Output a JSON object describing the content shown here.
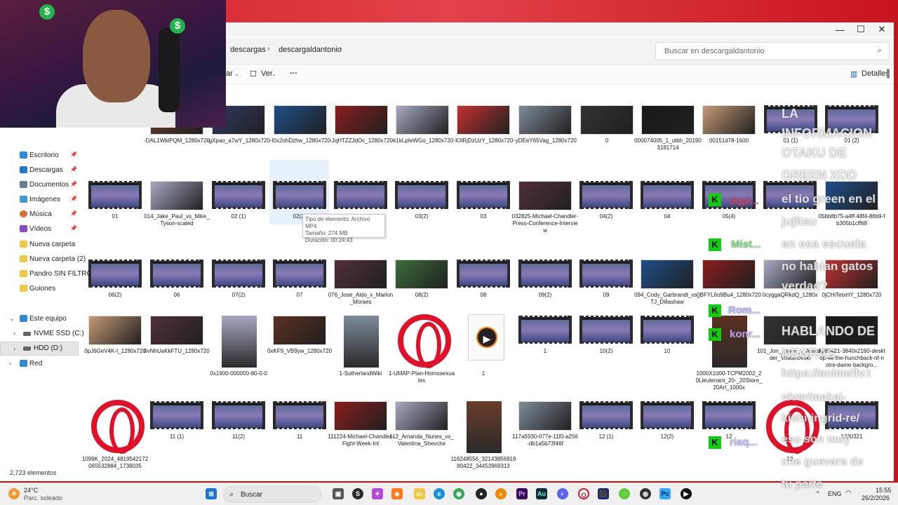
{
  "window": {
    "breadcrumbs": [
      "descargas",
      "descargaldantonio"
    ],
    "search_placeholder": "Buscar en descargaldantonio",
    "commands": {
      "sort_partial": "ar",
      "view": "Ver",
      "more": "···",
      "details": "Detalles"
    },
    "controls": {
      "minimize": "—",
      "maximize": "☐",
      "close": "✕"
    }
  },
  "sidebar": {
    "items": [
      {
        "label": "Escritorio",
        "icon": "desktop-icon",
        "pinned": true
      },
      {
        "label": "Descargas",
        "icon": "download-icon",
        "pinned": true
      },
      {
        "label": "Documentos",
        "icon": "document-icon",
        "pinned": true
      },
      {
        "label": "Imágenes",
        "icon": "image-icon",
        "pinned": true
      },
      {
        "label": "Música",
        "icon": "music-icon",
        "pinned": true
      },
      {
        "label": "Vídeos",
        "icon": "video-icon",
        "pinned": true
      },
      {
        "label": "Nueva carpeta",
        "icon": "folder-icon",
        "pinned": false
      },
      {
        "label": "Nueva carpeta (2)",
        "icon": "folder-icon",
        "pinned": false
      },
      {
        "label": "Pandro SIN FILTROS",
        "icon": "folder-icon",
        "pinned": false
      },
      {
        "label": "Guiones",
        "icon": "folder-icon",
        "pinned": false
      }
    ],
    "this_pc": "Este equipo",
    "drives": [
      "NVME SSD (C:)",
      "HDD (D:)"
    ],
    "network": "Red"
  },
  "files": {
    "row1": [
      "-DAL1WklPQM_1280x720",
      "-gXpao_a7wY_1280x720",
      "-l0x2ohDzhw_1280x720",
      "-JqHTZZJdOc_1280x720",
      "-k1kLpIeWGo_1280x720",
      "-lOIRjDzUzY_1280x720",
      "-yDEeY65Vag_1280x720",
      "0",
      "000074005_1_utbh_201903181714",
      "00151d78-1600",
      "01 (1)",
      "01 (2)"
    ],
    "row2": [
      "01",
      "014_Jake_Paul_vs_Mike_Tyson-scaled",
      "02 (1)",
      "02(2)",
      "",
      "03(2)",
      "03",
      "032825-Michael-Chandler-Press-Conference-Interview",
      "04(2)",
      "04",
      "05(4)",
      "",
      "05bb8b75-a4ff-48f4-86b9-fb305b1cff68"
    ],
    "row3": [
      "06(2)",
      "06",
      "07(2)",
      "07",
      "076_Jose_Aldo_x_Marlon_Moraes",
      "08(2)",
      "08",
      "09(2)",
      "09",
      "094_Cody_Garbrandt_vs_TJ_Dillashaw",
      "0BFYL6o9Bu4_1280x720",
      "0cyggaQRkdQ_1280x",
      "0jCHiTetxHY_1280x720"
    ],
    "row4": [
      "0pJ6GeV4K-I_1280x720",
      "0vNhUaKkFTU_1280x720",
      "0x1900-000000-80-0-0",
      "0xKF9_VB9yw_1280x720",
      "1-SutherlandWiki",
      "1-UMAP-Plan-Homosexuales",
      "1",
      "1",
      "10(2)",
      "10",
      "1000X1000-TCPM2002_20Lieutenant_20-_20Store_20Art_1000x",
      "101_Jon_Jones_x_Alexander_Volkanovski",
      "1085421-3840x2160-desktop-4k-the-hunchback-of-notre-dame-backgro..."
    ],
    "row5": [
      "1099K_2024_4819542172065532884_1738035",
      "11 (1)",
      "11(2)",
      "11",
      "111224-Michael-Chandler-Fight-Week-Int",
      "112_Amanda_Nunes_vs_Valentina_Shevche",
      "116248556_3214385691980422_34453969313",
      "117a5930-077e-11f0-a256-db1a5b73f46f",
      "12 (1)",
      "12(2)",
      "12",
      "12",
      "1230321"
    ]
  },
  "tooltip": {
    "type": "Tipo de elemento: Archivo MP4",
    "size": "Tamaño: 274 MB",
    "duration": "Duración: 00:24:43"
  },
  "status": {
    "count": "2,723 elementos"
  },
  "overlay_chat": [
    "LA",
    "INFORMACION",
    "OTAKU DE",
    "GREEN XDD",
    "el tio green en el",
    "jujitsu",
    "en esa escuela",
    "no habian gatos",
    "verdad?",
    "HABLANDO DE",
    "NEGRAS",
    "https://animeflv.t",
    "v/ver/makai-",
    "kishi-ingrid-re/",
    "eso son muy",
    "che guevara de",
    "tu parte"
  ],
  "chat_users": [
    "dqpi...",
    "Mist...",
    "Rom...",
    "konr...",
    "riaq..."
  ],
  "taskbar": {
    "weather_temp": "24°C",
    "weather_desc": "Parc. soleado",
    "search": "Buscar",
    "lang": "ENG",
    "time": "15:55",
    "date": "26/2/2026"
  },
  "colors": {
    "accent": "#0067c0",
    "opera_red": "#e0122a",
    "kick_green": "#0bd10b",
    "bg_red": "#c0151b"
  }
}
